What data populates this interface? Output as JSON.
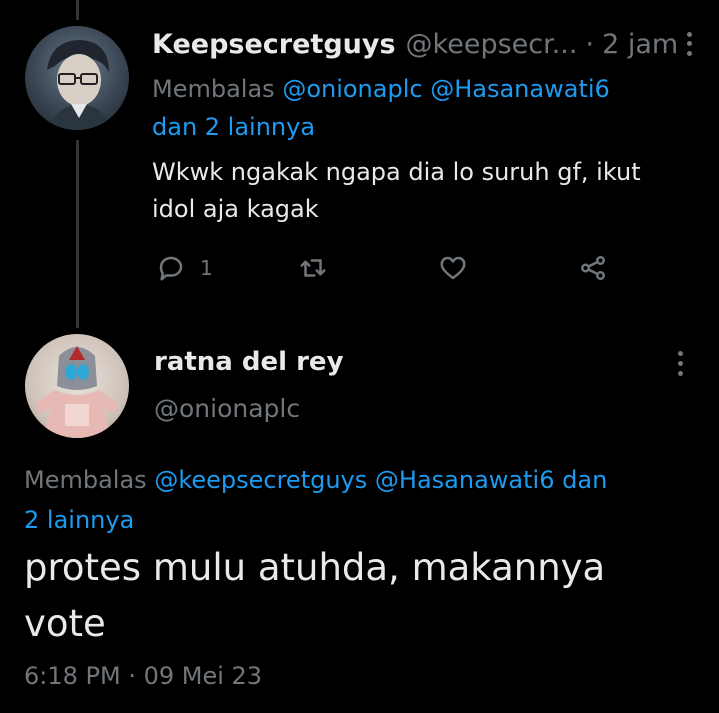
{
  "reply": {
    "display_name": "Keepsecretguys",
    "handle": "@keepsecr...",
    "separator": "·",
    "time": "2 jam",
    "replying_prefix": "Membalas",
    "mention_1": "@onionaplc",
    "mention_2": "@Hasanawati6",
    "others": "dan 2 lainnya",
    "text_line_1": "Wkwk ngakak ngapa dia lo suruh gf, ikut",
    "text_line_2": "idol aja kagak",
    "reply_count": "1"
  },
  "main_tweet": {
    "display_name": "ratna del rey",
    "handle": "@onionaplc",
    "replying_prefix": "Membalas",
    "mention_1": "@keepsecretguys",
    "mention_2": "@Hasanawati6",
    "others_1": "dan",
    "others_2": "2 lainnya",
    "text_line_1": "protes mulu atuhda, makannya",
    "text_line_2": "vote",
    "timestamp": "6:18 PM · 09 Mei 23"
  },
  "colors": {
    "background": "#000000",
    "text": "#e7e9ea",
    "muted": "#71767b",
    "link": "#1d9bf0"
  }
}
